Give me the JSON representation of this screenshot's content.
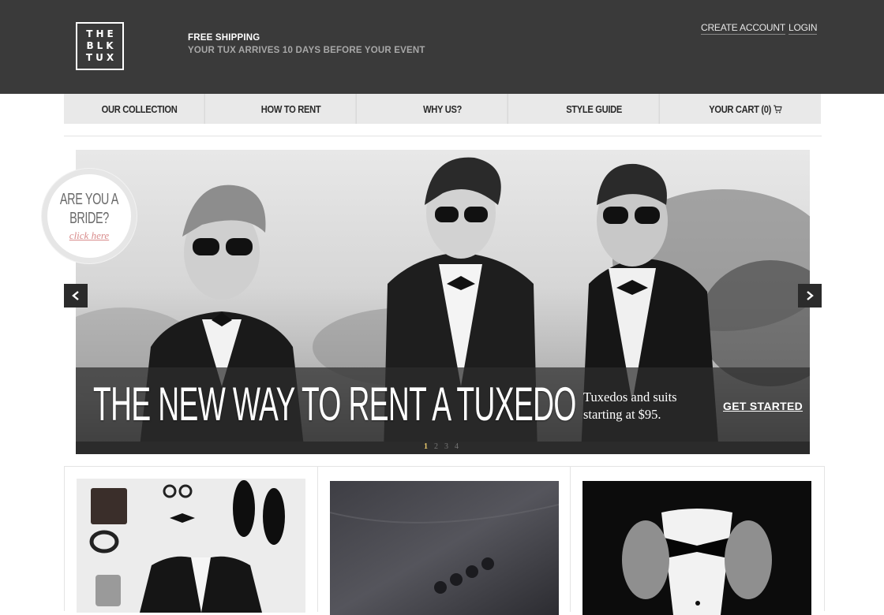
{
  "header": {
    "logo": [
      "THE",
      "BLK",
      "TUX"
    ],
    "shipping_title": "FREE SHIPPING",
    "shipping_sub": "YOUR TUX ARRIVES 10 DAYS BEFORE YOUR EVENT",
    "create_account": "CREATE ACCOUNT",
    "login": "LOGIN"
  },
  "nav": {
    "items": [
      {
        "label": "OUR COLLECTION"
      },
      {
        "label": "HOW TO RENT"
      },
      {
        "label": "WHY US?"
      },
      {
        "label": "STYLE GUIDE"
      },
      {
        "label": "YOUR CART (0)",
        "icon": "cart-icon"
      }
    ]
  },
  "bride_badge": {
    "line1": "ARE YOU A",
    "line2": "BRIDE?",
    "link": "click here"
  },
  "hero": {
    "headline": "THE NEW WAY TO RENT A TUXEDO",
    "sub_line1": "Tuxedos and suits",
    "sub_line2": "starting at $95.",
    "cta": "GET STARTED",
    "slides": [
      "1",
      "2",
      "3",
      "4"
    ],
    "active_slide": "1"
  },
  "colors": {
    "header_bg": "#3a3a3a",
    "nav_bg": "#e9e9e9",
    "bride_link": "#d88a8a",
    "active_dot": "#e8c86b"
  }
}
